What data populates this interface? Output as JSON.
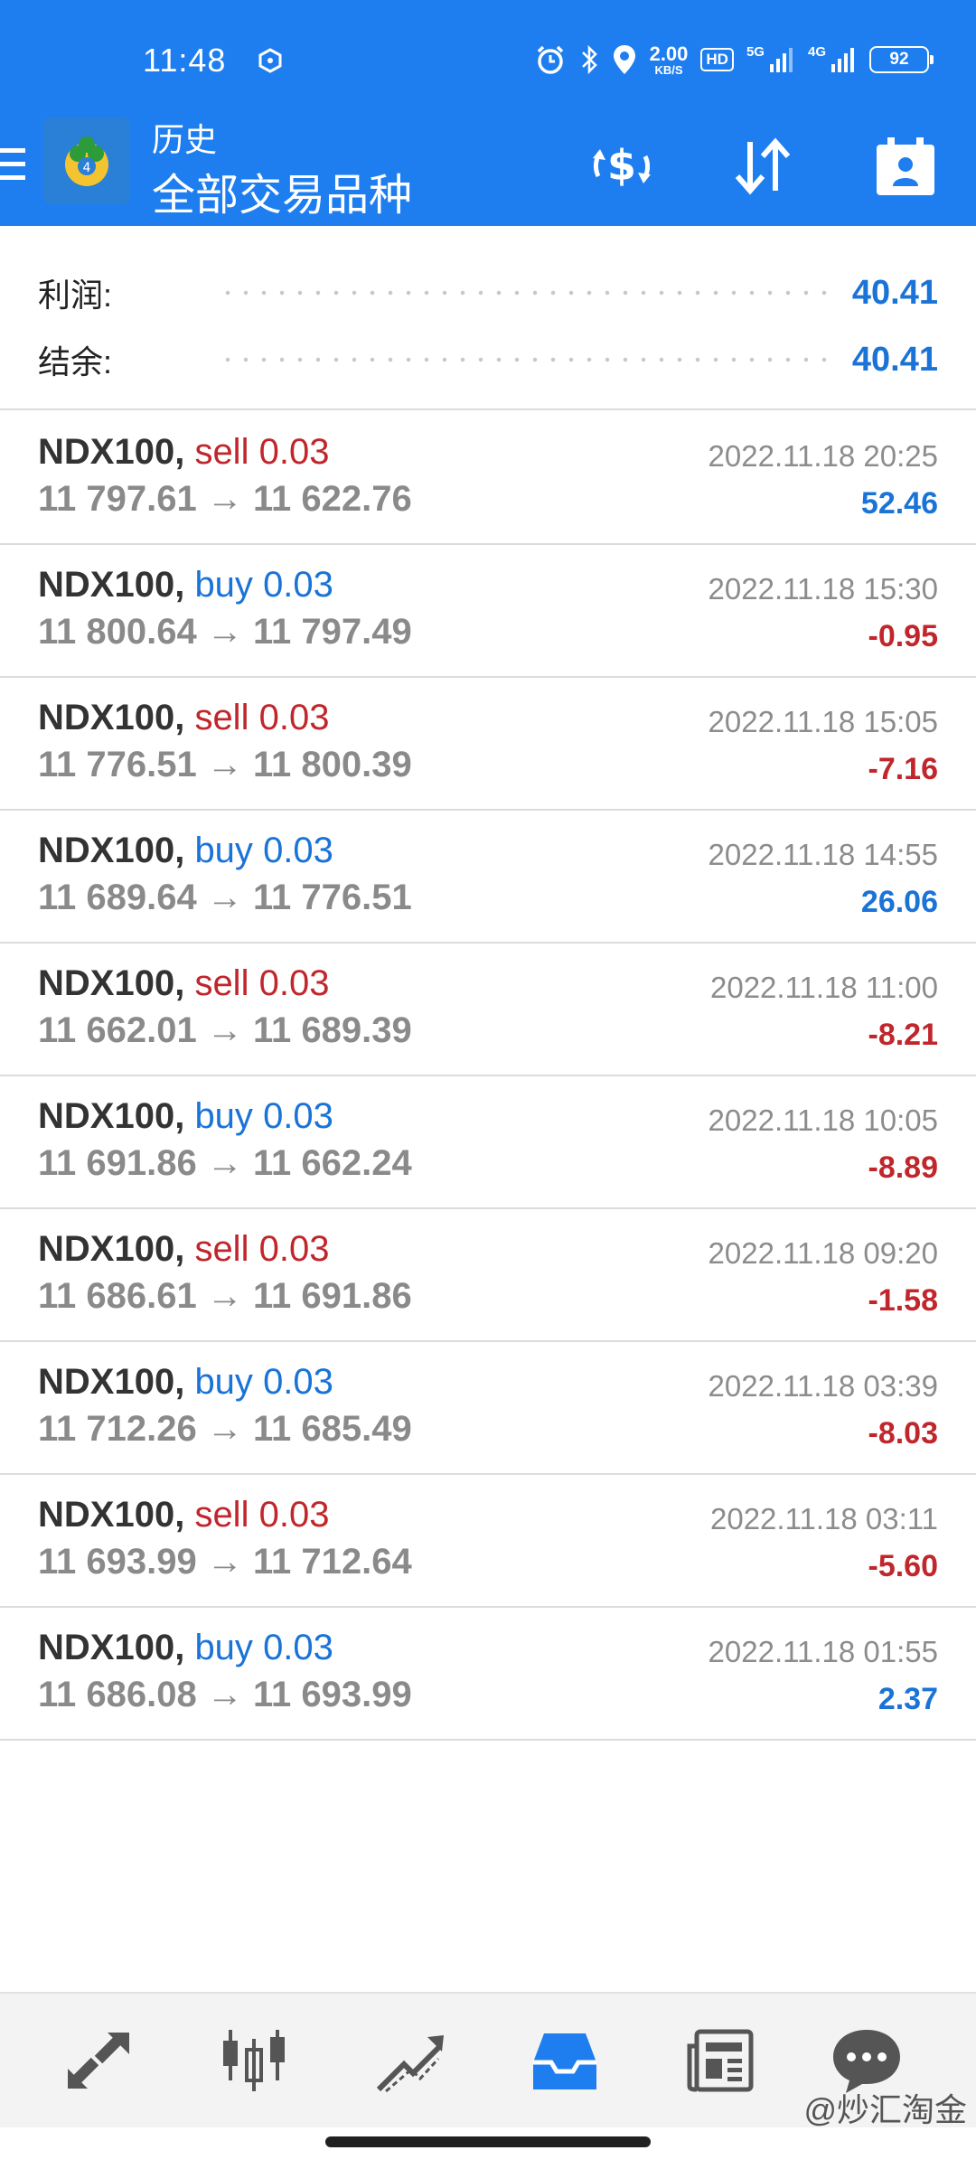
{
  "status_bar": {
    "time": "11:48",
    "net_speed_value": "2.00",
    "net_speed_unit": "KB/S",
    "hd_label": "HD",
    "signal1_label": "5G",
    "signal2_label": "4G",
    "battery": "92",
    "icons": [
      "alarm-icon",
      "bluetooth-icon",
      "location-icon"
    ]
  },
  "app_bar": {
    "subtitle": "历史",
    "title": "全部交易品种",
    "actions": [
      "deposit-exchange-icon",
      "sort-icon",
      "calendar-account-icon"
    ]
  },
  "summary": {
    "profit_label": "利润:",
    "profit_value": "40.41",
    "balance_label": "结余:",
    "balance_value": "40.41"
  },
  "trades": [
    {
      "symbol": "NDX100,",
      "type": "sell",
      "lots": "0.03",
      "open": "11 797.61",
      "close": "11 622.76",
      "date": "2022.11.18 20:25",
      "profit": "52.46"
    },
    {
      "symbol": "NDX100,",
      "type": "buy",
      "lots": "0.03",
      "open": "11 800.64",
      "close": "11 797.49",
      "date": "2022.11.18 15:30",
      "profit": "-0.95"
    },
    {
      "symbol": "NDX100,",
      "type": "sell",
      "lots": "0.03",
      "open": "11 776.51",
      "close": "11 800.39",
      "date": "2022.11.18 15:05",
      "profit": "-7.16"
    },
    {
      "symbol": "NDX100,",
      "type": "buy",
      "lots": "0.03",
      "open": "11 689.64",
      "close": "11 776.51",
      "date": "2022.11.18 14:55",
      "profit": "26.06"
    },
    {
      "symbol": "NDX100,",
      "type": "sell",
      "lots": "0.03",
      "open": "11 662.01",
      "close": "11 689.39",
      "date": "2022.11.18 11:00",
      "profit": "-8.21"
    },
    {
      "symbol": "NDX100,",
      "type": "buy",
      "lots": "0.03",
      "open": "11 691.86",
      "close": "11 662.24",
      "date": "2022.11.18 10:05",
      "profit": "-8.89"
    },
    {
      "symbol": "NDX100,",
      "type": "sell",
      "lots": "0.03",
      "open": "11 686.61",
      "close": "11 691.86",
      "date": "2022.11.18 09:20",
      "profit": "-1.58"
    },
    {
      "symbol": "NDX100,",
      "type": "buy",
      "lots": "0.03",
      "open": "11 712.26",
      "close": "11 685.49",
      "date": "2022.11.18 03:39",
      "profit": "-8.03"
    },
    {
      "symbol": "NDX100,",
      "type": "sell",
      "lots": "0.03",
      "open": "11 693.99",
      "close": "11 712.64",
      "date": "2022.11.18 03:11",
      "profit": "-5.60"
    },
    {
      "symbol": "NDX100,",
      "type": "buy",
      "lots": "0.03",
      "open": "11 686.08",
      "close": "11 693.99",
      "date": "2022.11.18 01:55",
      "profit": "2.37"
    }
  ],
  "bottom_nav": {
    "items": [
      "quotes-icon",
      "chart-icon",
      "trade-icon",
      "history-icon",
      "news-icon",
      "chat-icon"
    ],
    "active": "history-icon"
  },
  "watermark": "@炒汇淘金",
  "colors": {
    "primary": "#1e7ef0",
    "profit_positive": "#1a73d6",
    "profit_negative": "#c0262b",
    "sell": "#c0262b",
    "buy": "#1a73d6"
  }
}
